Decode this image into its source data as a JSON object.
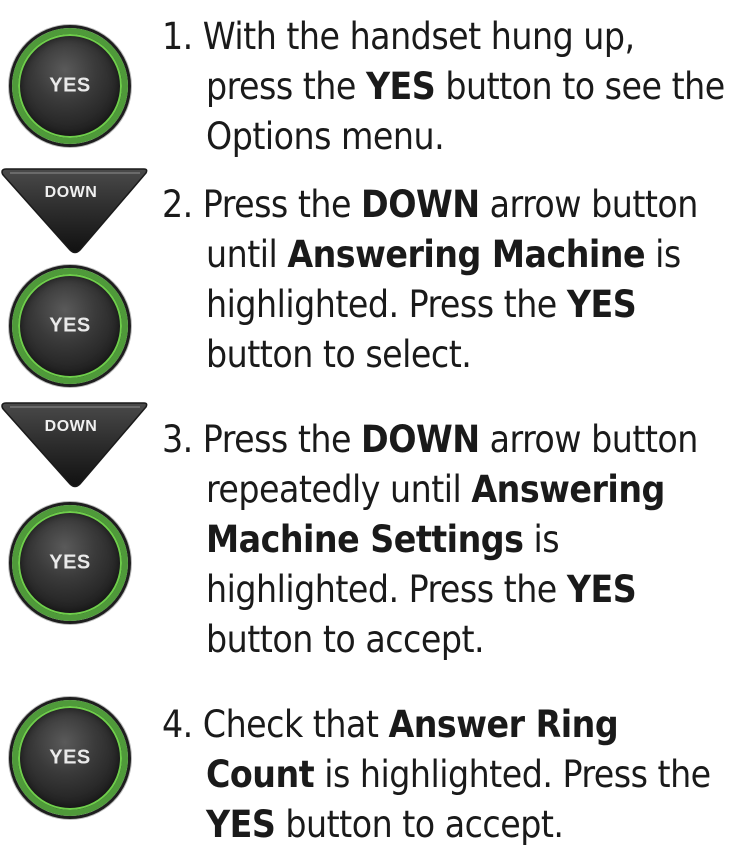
{
  "keys": {
    "yes_label": "YES",
    "down_label": "DOWN",
    "colors": {
      "yes_ring": "#4f9a3a",
      "yes_ring_glow": "#6fcf4b",
      "key_body": "#2a2a2a"
    }
  },
  "steps": [
    {
      "lines": [
        [
          "1. With the handset hung up,"
        ],
        [
          "press the ",
          {
            "b": "YES"
          },
          " button to see the"
        ],
        [
          "Options menu."
        ]
      ]
    },
    {
      "lines": [
        [
          "2. Press the ",
          {
            "b": "DOWN"
          },
          " arrow button"
        ],
        [
          "until ",
          {
            "b": "Answering Machine"
          },
          " is"
        ],
        [
          "highlighted. Press the ",
          {
            "b": "YES"
          }
        ],
        [
          "button to select."
        ]
      ]
    },
    {
      "lines": [
        [
          "3. Press the ",
          {
            "b": "DOWN"
          },
          " arrow button"
        ],
        [
          "repeatedly until ",
          {
            "b": "Answering"
          }
        ],
        [
          {
            "b": "Machine Settings"
          },
          " is"
        ],
        [
          "highlighted. Press the ",
          {
            "b": "YES"
          }
        ],
        [
          "button to accept."
        ]
      ]
    },
    {
      "lines": [
        [
          "4. Check that ",
          {
            "b": "Answer Ring"
          }
        ],
        [
          {
            "b": "Count"
          },
          " is highlighted. Press the"
        ],
        [
          {
            "b": "YES"
          },
          " button to accept."
        ]
      ]
    }
  ]
}
